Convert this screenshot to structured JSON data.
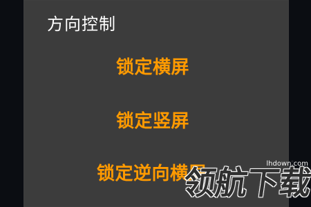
{
  "dialog": {
    "title": "方向控制",
    "options": [
      "锁定横屏",
      "锁定竖屏",
      "锁定逆向横屏"
    ]
  },
  "watermark": {
    "url": "lhdown.com",
    "text": "领航下载"
  },
  "colors": {
    "background": "#0b0d12",
    "panel": "#3c3c3c",
    "title_text": "#ffffff",
    "option_text": "#ff9a00"
  }
}
